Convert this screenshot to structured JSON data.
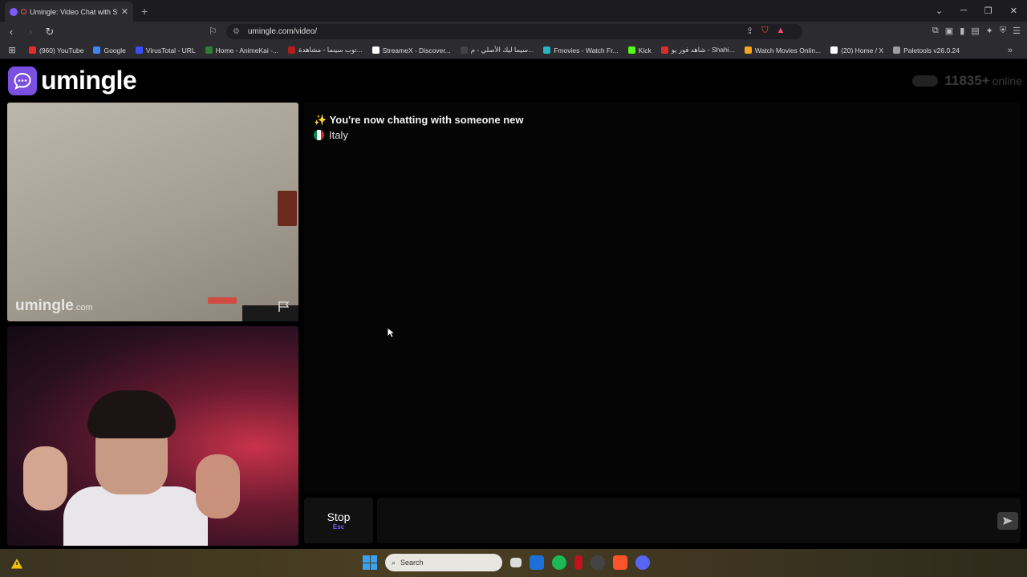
{
  "browser": {
    "tab_title": "Umingle: Video Chat with Str",
    "new_tab": "+",
    "url": "umingle.com/video/",
    "bookmarks": [
      {
        "label": "(960) YouTube",
        "color": "#e52d27"
      },
      {
        "label": "Google",
        "color": "#4285f4"
      },
      {
        "label": "VirusTotal - URL",
        "color": "#394eff"
      },
      {
        "label": "Home - AnimeKai -...",
        "color": "#2e7d32"
      },
      {
        "label": "توب سينما - مشاهدة...",
        "color": "#b71c1c"
      },
      {
        "label": "StreameX - Discover...",
        "color": "#ffffff"
      },
      {
        "label": "سيما ليك الأصلي - م...",
        "color": "#444444"
      },
      {
        "label": "Fmovies - Watch Fr...",
        "color": "#2bb3c0"
      },
      {
        "label": "Kick",
        "color": "#53fc18"
      },
      {
        "label": "شاهد فور يو - Shahi...",
        "color": "#d32f2f"
      },
      {
        "label": "Watch Movies Onlin...",
        "color": "#f5a623"
      },
      {
        "label": "(20) Home / X",
        "color": "#ffffff"
      },
      {
        "label": "Paletools v26.0.24",
        "color": "#9e9e9e"
      }
    ]
  },
  "site": {
    "logo_text": "umingle",
    "online_count": "11835+",
    "online_label": "online",
    "accent": "#7b4fe0"
  },
  "video": {
    "watermark_main": "umingle",
    "watermark_domain": ".com"
  },
  "chat": {
    "status_message": "✨ You're now chatting with someone new",
    "country": "Italy",
    "stop_label": "Stop",
    "stop_shortcut": "Esc",
    "input_value": ""
  },
  "taskbar": {
    "search_placeholder": "Search"
  }
}
